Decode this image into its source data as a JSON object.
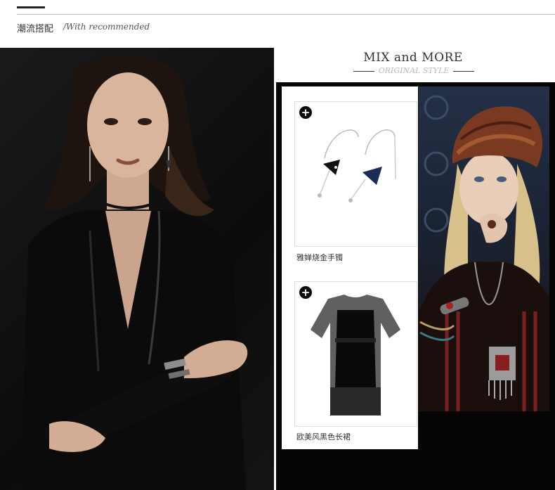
{
  "header": {
    "title_cn": "潮流搭配",
    "title_en": "/With recommended"
  },
  "section": {
    "title": "MIX and MORE",
    "subtitle": "ORIGINAL STYLE"
  },
  "products": [
    {
      "icon": "plus-icon",
      "label": "雅婵烧金手镯"
    },
    {
      "icon": "plus-icon",
      "label": "欧美风黑色长裙"
    }
  ],
  "colors": {
    "panel": "#050505",
    "accent": "#222222"
  }
}
